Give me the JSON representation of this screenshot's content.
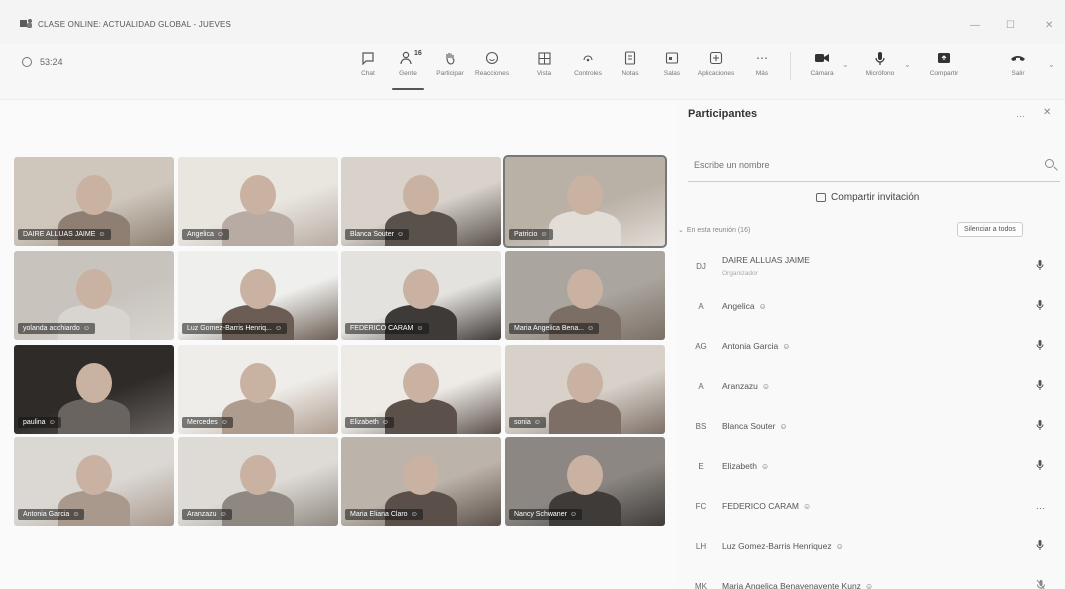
{
  "window": {
    "title": "CLASE ONLINE: ACTUALIDAD GLOBAL - JUEVES",
    "minimize": "—",
    "maximize": "☐",
    "close": "✕"
  },
  "toolbar": {
    "timer": "53:24",
    "count_people": "16",
    "items": [
      {
        "label": "Chat"
      },
      {
        "label": "Gente"
      },
      {
        "label": "Participar"
      },
      {
        "label": "Reacciones"
      },
      {
        "label": "Vista"
      },
      {
        "label": "Controles"
      },
      {
        "label": "Notas"
      },
      {
        "label": "Salas"
      },
      {
        "label": "Aplicaciones"
      },
      {
        "label": "Más"
      },
      {
        "label": "Cámara"
      },
      {
        "label": "Micrófono"
      },
      {
        "label": "Compartir"
      },
      {
        "label": "Salir"
      }
    ]
  },
  "grid": {
    "tiles": [
      {
        "name": "DAIRE ALLUAS JAIME",
        "icon": "speaking",
        "bg": "#cfc7bc",
        "bg2": "#8e7f72"
      },
      {
        "name": "Angelica",
        "icon": "person",
        "bg": "#e9e6e0",
        "bg2": "#b8aba3"
      },
      {
        "name": "Blanca Souter",
        "icon": "person",
        "bg": "#d8d2cb",
        "bg2": "#59514c"
      },
      {
        "name": "Patricio",
        "icon": "person",
        "bg": "#b9b0a6",
        "bg2": "#e2ddd6"
      },
      {
        "name": "yolanda acchiardo",
        "icon": "person",
        "bg": "#c8c3bd",
        "bg2": "#d8d4cf"
      },
      {
        "name": "Luz Gomez-Barris Henriq...",
        "icon": "person",
        "bg": "#efefed",
        "bg2": "#6b5d53"
      },
      {
        "name": "FEDERICO CARAM",
        "icon": "person",
        "bg": "#e4e2df",
        "bg2": "#3e3a37"
      },
      {
        "name": "Maria Angelica Bena...",
        "icon": "person",
        "bg": "#aaa59e",
        "bg2": "#7b6f65"
      },
      {
        "name": "paulina",
        "icon": "person",
        "bg": "#2e2b29",
        "bg2": "#6a6460"
      },
      {
        "name": "Mercedes",
        "icon": "person",
        "bg": "#efede9",
        "bg2": "#ae9c8e"
      },
      {
        "name": "Elizabeth",
        "icon": "person",
        "bg": "#eeebe7",
        "bg2": "#5c504a"
      },
      {
        "name": "sonia",
        "icon": "person",
        "bg": "#d7d1ca",
        "bg2": "#7d6f66"
      },
      {
        "name": "Antonia Garcia",
        "icon": "person",
        "bg": "#dbd8d4",
        "bg2": "#a9998d"
      },
      {
        "name": "Aranzazu",
        "icon": "person",
        "bg": "#dedbd6",
        "bg2": "#8f8881"
      },
      {
        "name": "Maria Eliana Claro",
        "icon": "person",
        "bg": "#bcb3aa",
        "bg2": "#5a5049"
      },
      {
        "name": "Nancy Schwaner",
        "icon": "person",
        "bg": "#8c8782",
        "bg2": "#3f3b39"
      }
    ]
  },
  "panel": {
    "title": "Participantes",
    "more": "…",
    "close": "✕",
    "search_placeholder": "Escribe un nombre",
    "invite_label": "Compartir invitación",
    "section_label": "En esta reunión (16)",
    "mute_all": "Silenciar a todos",
    "participants": [
      {
        "initials": "DJ",
        "name": "DAIRE ALLUAS JAIME",
        "sub": "Organizador",
        "status": "mic",
        "guest": false
      },
      {
        "initials": "A",
        "name": "Angelica",
        "sub": "",
        "status": "mic",
        "guest": true
      },
      {
        "initials": "AG",
        "name": "Antonia Garcia",
        "sub": "",
        "status": "mic",
        "guest": true
      },
      {
        "initials": "A",
        "name": "Aranzazu",
        "sub": "",
        "status": "mic",
        "guest": true
      },
      {
        "initials": "BS",
        "name": "Blanca Souter",
        "sub": "",
        "status": "mic",
        "guest": true
      },
      {
        "initials": "E",
        "name": "Elizabeth",
        "sub": "",
        "status": "mic",
        "guest": true
      },
      {
        "initials": "FC",
        "name": "FEDERICO CARAM",
        "sub": "",
        "status": "more",
        "guest": true
      },
      {
        "initials": "LH",
        "name": "Luz Gomez-Barris Henriquez",
        "sub": "",
        "status": "mic",
        "guest": true
      },
      {
        "initials": "MK",
        "name": "Maria Angelica Benavenavente Kunz",
        "sub": "",
        "status": "mic-off",
        "guest": true
      }
    ]
  }
}
